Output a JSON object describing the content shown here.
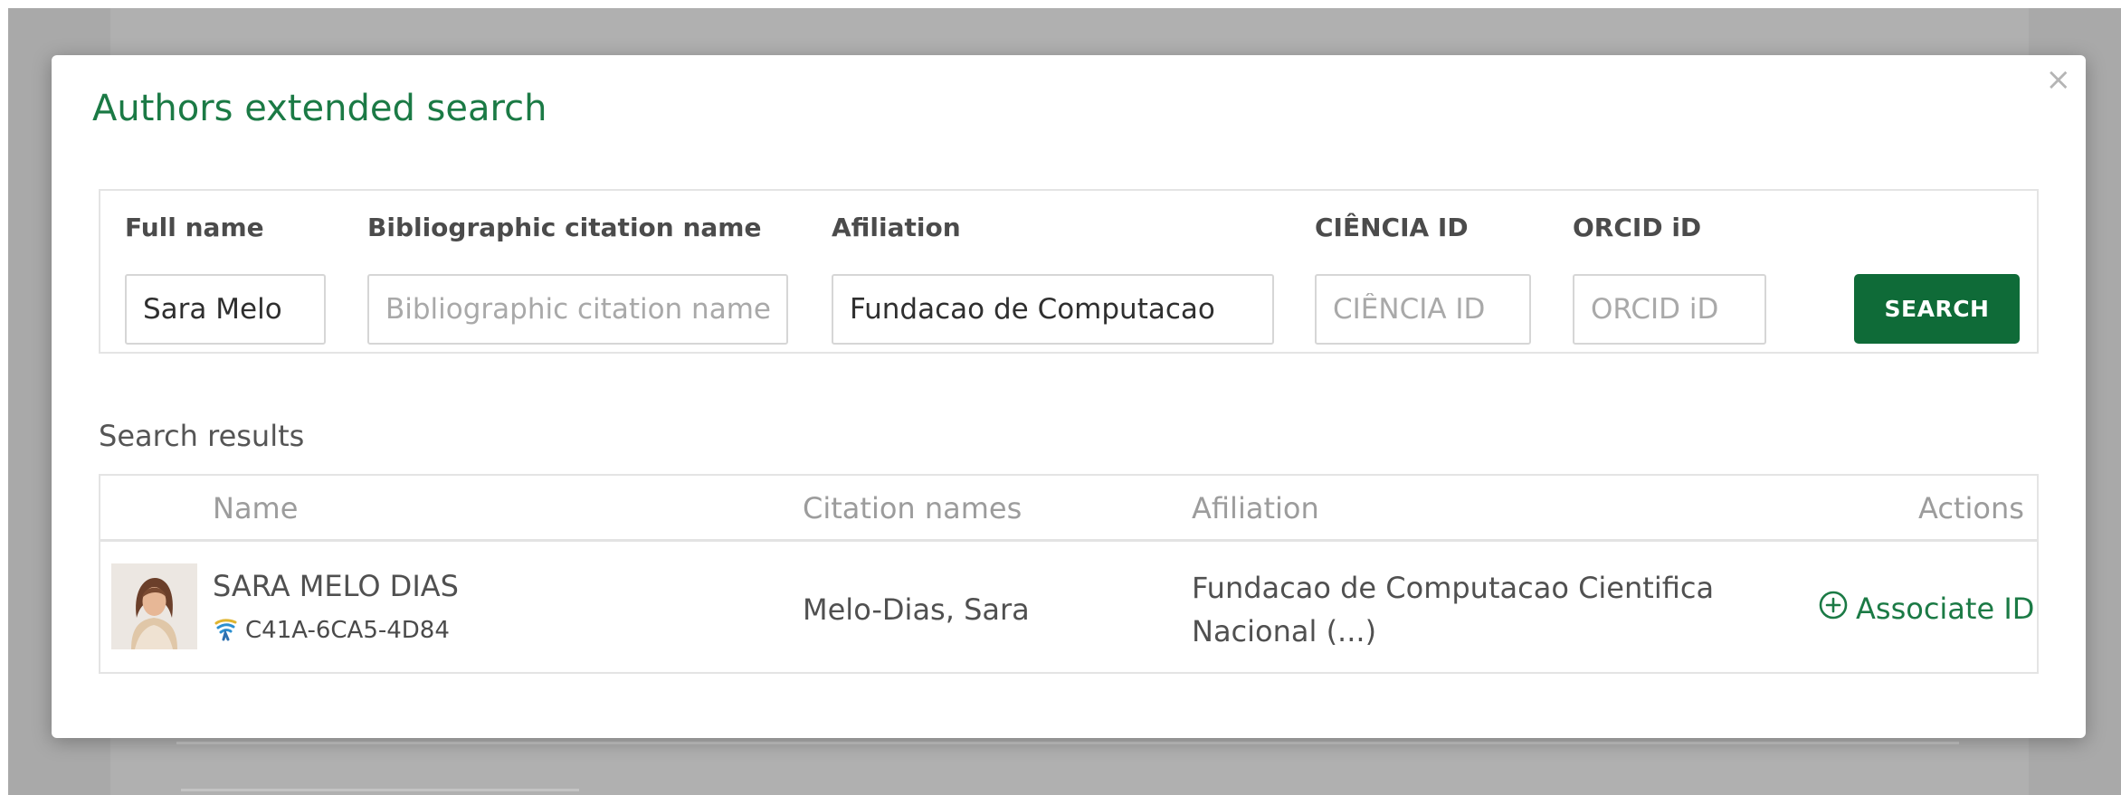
{
  "modal": {
    "title": "Authors extended search",
    "close_symbol": "×"
  },
  "form": {
    "fields": [
      {
        "label": "Full name",
        "value": "Sara Melo",
        "placeholder": ""
      },
      {
        "label": "Bibliographic citation name",
        "value": "",
        "placeholder": "Bibliographic citation name"
      },
      {
        "label": "Afiliation",
        "value": "Fundacao de Computacao",
        "placeholder": ""
      },
      {
        "label": "CIÊNCIA ID",
        "value": "",
        "placeholder": "CIÊNCIA ID"
      },
      {
        "label": "ORCID iD",
        "value": "",
        "placeholder": "ORCID iD"
      }
    ],
    "search_label": "SEARCH"
  },
  "results": {
    "label": "Search results",
    "headers": [
      "Name",
      "Citation names",
      "Afiliation",
      "Actions"
    ],
    "rows": [
      {
        "name": "SARA MELO DIAS",
        "id_icon": "ciencia-id-icon",
        "ciencia_id": "C41A-6CA5-4D84",
        "citation": "Melo-Dias, Sara",
        "affiliation": "Fundacao de Computacao Cientifica Nacional (...)",
        "action_label": "Associate ID",
        "action_icon": "plus-circle-icon"
      }
    ]
  },
  "colors": {
    "accent": "#1b7a45",
    "button": "#0f6b38",
    "backdrop": "#a9a9a9"
  }
}
